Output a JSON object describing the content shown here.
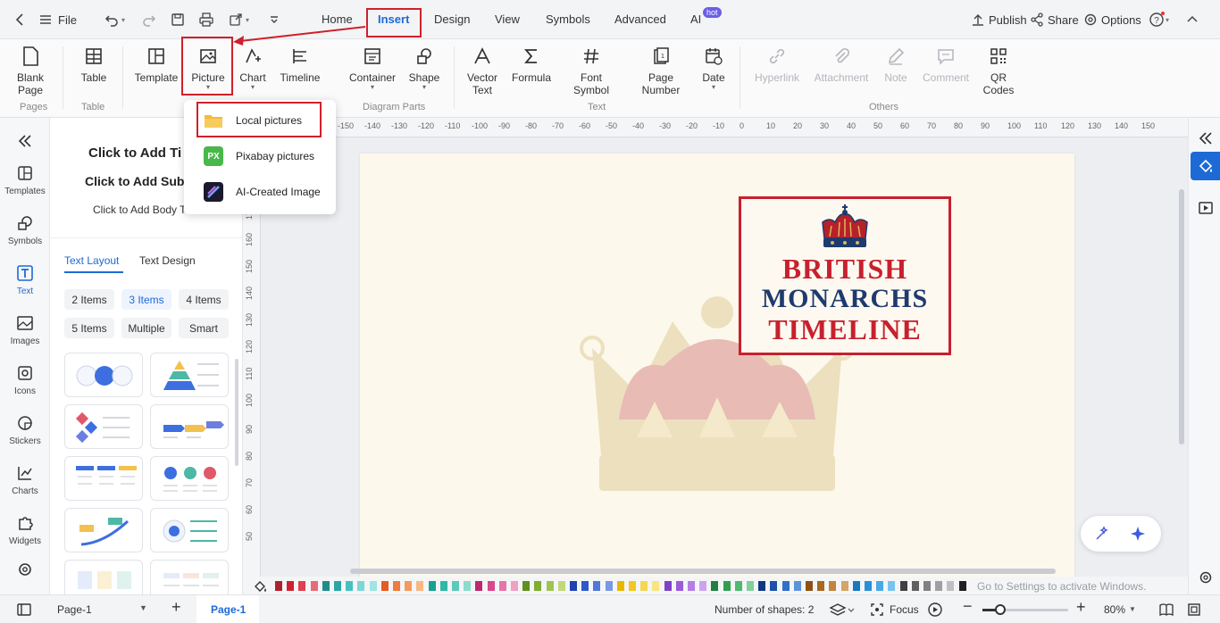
{
  "topbar": {
    "file_label": "File",
    "tabs": [
      {
        "label": "Home"
      },
      {
        "label": "Insert"
      },
      {
        "label": "Design"
      },
      {
        "label": "View"
      },
      {
        "label": "Symbols"
      },
      {
        "label": "Advanced"
      },
      {
        "label": "AI"
      }
    ],
    "hot_badge": "hot",
    "publish_label": "Publish",
    "share_label": "Share",
    "options_label": "Options"
  },
  "ribbon": {
    "pages_group": {
      "label": "Pages",
      "blank_page_line1": "Blank",
      "blank_page_line2": "Page"
    },
    "table_group": {
      "label": "Table",
      "table_button": "Table"
    },
    "diagram_group": {
      "label": "Diagram Parts",
      "template": "Template",
      "picture": "Picture",
      "chart": "Chart",
      "timeline": "Timeline",
      "container": "Container",
      "shape": "Shape"
    },
    "text_group": {
      "label": "Text",
      "vector_line1": "Vector",
      "vector_line2": "Text",
      "formula": "Formula",
      "font_line1": "Font",
      "font_line2": "Symbol",
      "page_line1": "Page",
      "page_line2": "Number",
      "date": "Date"
    },
    "others_group": {
      "label": "Others",
      "hyperlink": "Hyperlink",
      "attachment": "Attachment",
      "note": "Note",
      "comment": "Comment",
      "qr_line1": "QR",
      "qr_line2": "Codes"
    }
  },
  "picture_menu": {
    "items": [
      {
        "label": "Local pictures",
        "icon": "folder-icon"
      },
      {
        "label": "Pixabay pictures",
        "icon": "pixabay-icon",
        "icon_text": "PX"
      },
      {
        "label": "AI-Created Image",
        "icon": "ai-image-icon"
      }
    ]
  },
  "leftbar": {
    "items": [
      {
        "label": "Templates"
      },
      {
        "label": "Symbols"
      },
      {
        "label": "Text"
      },
      {
        "label": "Images"
      },
      {
        "label": "Icons"
      },
      {
        "label": "Stickers"
      },
      {
        "label": "Charts"
      },
      {
        "label": "Widgets"
      }
    ]
  },
  "leftpanel": {
    "title_text": "Click to Add Ti",
    "subtitle_text": "Click to Add Sub",
    "body_text": "Click to Add Body T",
    "tabs": [
      {
        "label": "Text Layout"
      },
      {
        "label": "Text Design"
      }
    ],
    "chips": [
      {
        "label": "2 Items"
      },
      {
        "label": "3 Items"
      },
      {
        "label": "4 Items"
      },
      {
        "label": "5 Items"
      },
      {
        "label": "Multiple"
      },
      {
        "label": "Smart"
      }
    ]
  },
  "ruler": {
    "h_ticks": [
      "-150",
      "-140",
      "-130",
      "-120",
      "-110",
      "-100",
      "-90",
      "-80",
      "-70",
      "-60",
      "-50",
      "-40",
      "-30",
      "-20",
      "-10",
      "0",
      "10",
      "20",
      "30",
      "40",
      "50",
      "60",
      "70",
      "80",
      "90",
      "100",
      "110",
      "120",
      "130",
      "140",
      "150"
    ],
    "v_ticks": [
      "170",
      "160",
      "150",
      "140",
      "130",
      "120",
      "110",
      "100",
      "90",
      "80",
      "70",
      "60",
      "50"
    ]
  },
  "canvas": {
    "title_line1": "BRITISH",
    "title_line2": "MONARCHS",
    "title_line3": "TIMELINE"
  },
  "statusbar": {
    "page_select": "Page-1",
    "page_tab": "Page-1",
    "shapes_label": "Number of shapes: 2",
    "focus_label": "Focus",
    "zoom": "80%"
  },
  "watermark": "Go to Settings to activate Windows.",
  "colors": {
    "accent": "#1d6ad6",
    "highlight_red": "#d0202b",
    "title_red": "#c8202e",
    "title_navy": "#1e3a6e"
  }
}
